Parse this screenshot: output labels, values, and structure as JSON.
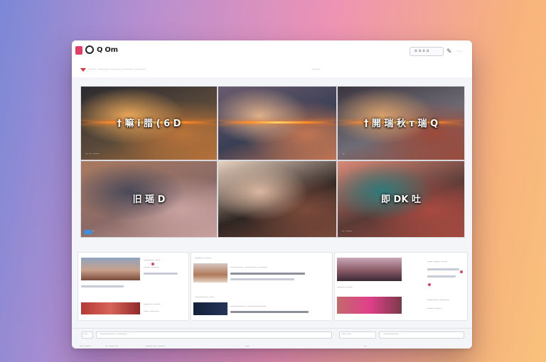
{
  "app": {
    "logo_text": "Q Om"
  },
  "toolbar": {
    "search_placeholder": "a a a a",
    "icons": [
      "pencil-icon",
      "more-icon"
    ]
  },
  "subbar": {
    "left_text": "----- ------- ------- ------- -------",
    "right_text": "-----"
  },
  "tiles": [
    {
      "caption": "† 嘛 i 腊 ( 6 D",
      "meta": "-- -- -----",
      "palette": [
        "#5b4a3a",
        "#b8733a",
        "#e8a658",
        "#2b2a30"
      ]
    },
    {
      "caption": "",
      "meta": "",
      "palette": [
        "#3a3f55",
        "#c27552",
        "#e0b08a",
        "#6b5b6e"
      ]
    },
    {
      "caption": "† 開 瑞 秋 т 瑞 Q",
      "meta": "--",
      "palette": [
        "#6f6c75",
        "#9b4a3a",
        "#d9a06a",
        "#3b3540"
      ]
    },
    {
      "caption": "旧 瑶 D",
      "meta": "-- ----",
      "palette": [
        "#8a6a66",
        "#c9a2a0",
        "#4a4a5a",
        "#a97a60"
      ]
    },
    {
      "caption": "",
      "meta": "",
      "palette": [
        "#2f2522",
        "#7b4a3a",
        "#d9b7a0",
        "#e8d2c0"
      ]
    },
    {
      "caption": "即 DK 吐",
      "meta": "-- -----",
      "palette": [
        "#5a3a36",
        "#a84a40",
        "#2f7a7a",
        "#d88a78"
      ]
    }
  ],
  "controls": {
    "left_label": "-----",
    "mid_label": "---- -----",
    "right_label": "-"
  },
  "panels": {
    "left": {
      "items": [
        {
          "title": "-------- ----",
          "sub": "----- ------"
        },
        {
          "title": "------- -----",
          "sub": "---- -------"
        }
      ]
    },
    "middle": {
      "items": [
        {
          "title": "------- -----",
          "sub": "---------- ---------- -------"
        },
        {
          "title": "----------- ---",
          "sub": "------------ ---------------"
        }
      ]
    },
    "right": {
      "items": [
        {
          "title": "------ -----",
          "sub": "---- ----- -----"
        },
        {
          "title": "-------- --------",
          "sub": "----- -----"
        }
      ]
    }
  },
  "bottombar": {
    "left_label": "---",
    "mid_label": "------------ --------",
    "right_label": "--- ---",
    "far_right_label": "------------"
  },
  "footer": {
    "items": [
      "--- -----",
      "-- ---- --",
      "----- --- -----",
      "---",
      "--"
    ]
  }
}
